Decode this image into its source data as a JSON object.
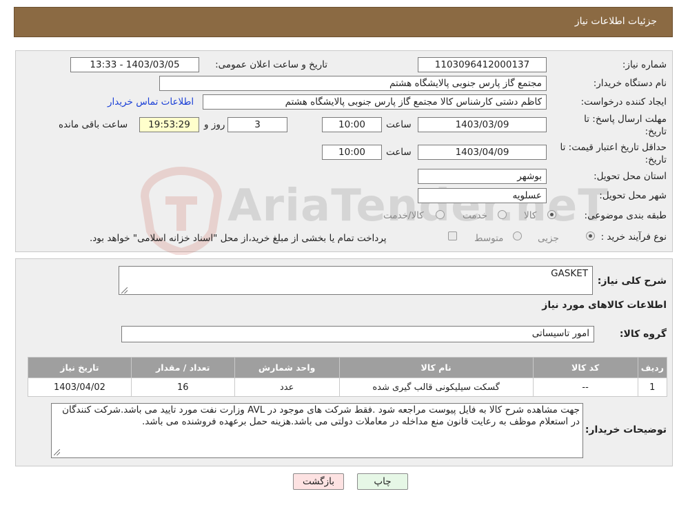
{
  "header": {
    "title": "جزئیات اطلاعات نیاز"
  },
  "details": {
    "need_number_label": "شماره نیاز:",
    "need_number": "1103096412000137",
    "announce_label": "تاریخ و ساعت اعلان عمومی:",
    "announce_value": "1403/03/05 - 13:33",
    "buyer_org_label": "نام دستگاه خریدار:",
    "buyer_org": "مجتمع گاز پارس جنوبی  پالایشگاه هشتم",
    "requester_label": "ایجاد کننده درخواست:",
    "requester": "کاظم دشتی کارشناس کالا مجتمع گاز پارس جنوبی  پالایشگاه هشتم",
    "contact_link": "اطلاعات تماس خریدار",
    "deadline_label_1": "مهلت ارسال پاسخ: تا",
    "deadline_label_2": "تاریخ:",
    "deadline_date": "1403/03/09",
    "time_label": "ساعت",
    "deadline_time": "10:00",
    "days_value": "3",
    "days_label": "روز و",
    "remaining_time": "19:53:29",
    "remaining_label": "ساعت باقی مانده",
    "validity_label_1": "حداقل تاریخ اعتبار قیمت: تا",
    "validity_label_2": "تاریخ:",
    "validity_date": "1403/04/09",
    "validity_time": "10:00",
    "province_label": "استان محل تحویل:",
    "province": "بوشهر",
    "city_label": "شهر محل تحویل:",
    "city": "عسلویه",
    "category_label": "طبقه بندی موضوعی:",
    "category_options": [
      "کالا",
      "خدمت",
      "کالا/خدمت"
    ],
    "process_label": "نوع فرآیند خرید :",
    "process_options": [
      "جزیی",
      "متوسط"
    ],
    "process_note": "پرداخت تمام یا بخشی از مبلغ خرید،از محل \"اسناد خزانه اسلامی\" خواهد بود."
  },
  "goods": {
    "summary_label": "شرح کلی نیاز:",
    "summary": "GASKET",
    "goods_info_title": "اطلاعات کالاهای مورد نیاز",
    "group_label": "گروه کالا:",
    "group": "امور تاسیساتی",
    "columns": [
      "ردیف",
      "کد کالا",
      "نام کالا",
      "واحد شمارش",
      "تعداد / مقدار",
      "تاریخ نیاز"
    ],
    "rows": [
      [
        "1",
        "--",
        "گسکت سیلیکونی قالب گیری شده",
        "عدد",
        "16",
        "1403/04/02"
      ]
    ],
    "buyer_notes_label": "توضیحات خریدار:",
    "buyer_notes": "جهت مشاهده شرح کالا به فایل پیوست مراجعه شود .فقط شرکت های موجود در AVL وزارت نفت مورد تایید می باشد.شرکت کنندگان در استعلام موظف به رعایت قانون منع مداخله در معاملات دولتی می باشد.هزینه حمل برعهده فروشنده می باشد."
  },
  "buttons": {
    "print": "چاپ",
    "back": "بازگشت"
  },
  "watermark": {
    "text": "AriaTender.neT"
  },
  "colors": {
    "header_bg": "#8b6a43",
    "panel_bg": "#efefef",
    "link": "#1a3fd6",
    "back_btn_bg": "#fde2e2",
    "print_btn_bg": "#e6f7e6"
  }
}
